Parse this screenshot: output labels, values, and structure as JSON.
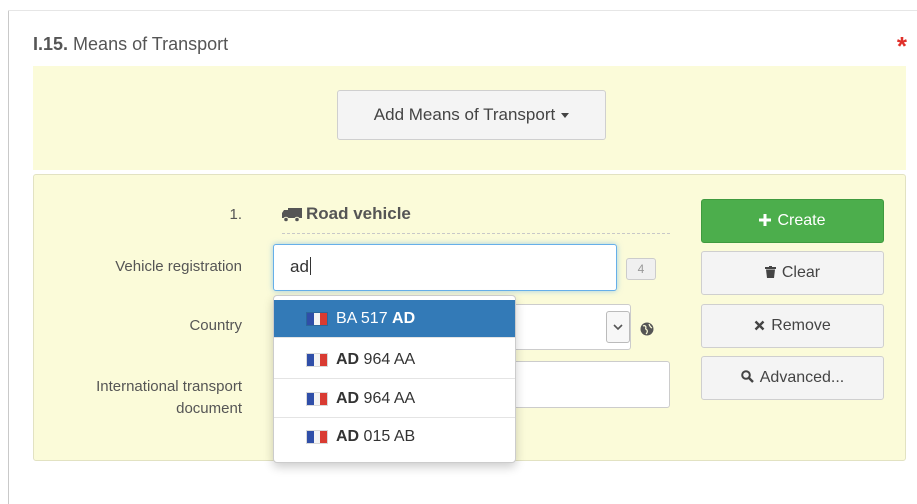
{
  "section": {
    "code": "I.15.",
    "title": "Means of Transport",
    "required_mark": "*"
  },
  "add_button": {
    "label": "Add Means of Transport"
  },
  "entry": {
    "number": "1.",
    "type_title": "Road vehicle",
    "vehicle_registration": {
      "label": "Vehicle registration",
      "value": "ad",
      "counter": "4"
    },
    "country": {
      "label": "Country",
      "value": ""
    },
    "itd": {
      "label_line1": "International transport",
      "label_line2": "document",
      "value": ""
    }
  },
  "suggestions": [
    {
      "prefix": "BA 517 ",
      "bold": "AD",
      "suffix": "",
      "active": true
    },
    {
      "prefix": "",
      "bold": "AD",
      "suffix": " 964 AA",
      "active": false
    },
    {
      "prefix": "",
      "bold": "AD",
      "suffix": " 964 AA",
      "active": false
    },
    {
      "prefix": "",
      "bold": "AD",
      "suffix": " 015 AB",
      "active": false
    }
  ],
  "actions": {
    "create": "Create",
    "clear": "Clear",
    "remove": "Remove",
    "advanced": "Advanced..."
  },
  "colors": {
    "create": "#4cae4c",
    "highlight": "#337ab7",
    "required": "#e0302a",
    "panel": "#fbfbd9"
  }
}
